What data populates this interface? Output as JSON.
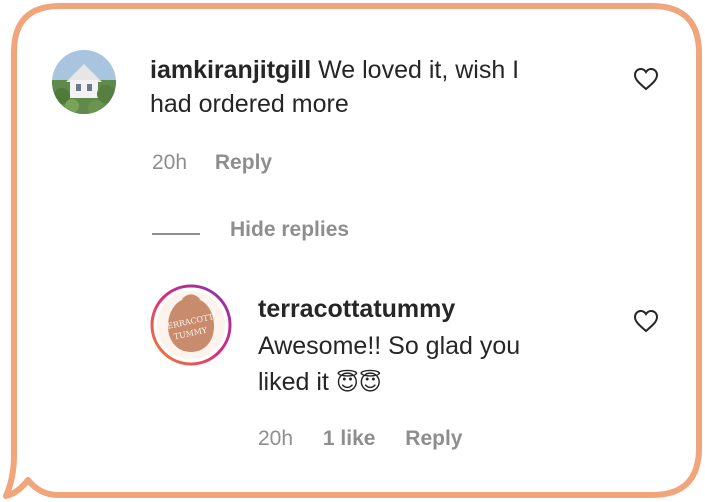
{
  "comment": {
    "username": "iamkiranjitgill",
    "text_line1": "We loved it, wish I",
    "text_line2": "had ordered more",
    "time": "20h",
    "reply_label": "Reply"
  },
  "hide_replies_label": "Hide replies",
  "reply": {
    "username": "terracottatummy",
    "text_line1": "Awesome!! So glad you",
    "text_line2": "liked it",
    "emoji": "😇😇",
    "time": "20h",
    "likes_label": "1 like",
    "reply_label": "Reply",
    "avatar_logo_line1": "TERRACOTTA",
    "avatar_logo_line2": "TUMMY"
  },
  "colors": {
    "bubble_border": "#f0a57a",
    "secondary_text": "#8e8e8e",
    "story_ring": "#c13584",
    "logo_bg": "#c88b6d"
  }
}
